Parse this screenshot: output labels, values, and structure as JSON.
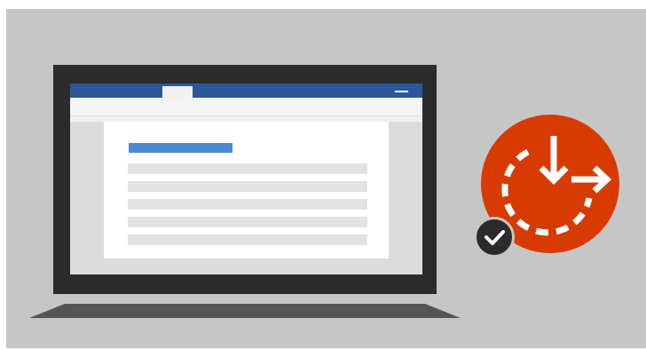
{
  "colors": {
    "panel": "#c6c6c6",
    "bezel": "#2b2b2b",
    "accent": "#2b579a",
    "heading": "#4a8ad0",
    "badge": "#d83b01",
    "check_bg": "#2b2b2b"
  },
  "icons": {
    "badge": "automatic-update-clock-icon",
    "check": "checkmark-icon",
    "device": "laptop-icon"
  },
  "document": {
    "text_line_count": 5
  }
}
